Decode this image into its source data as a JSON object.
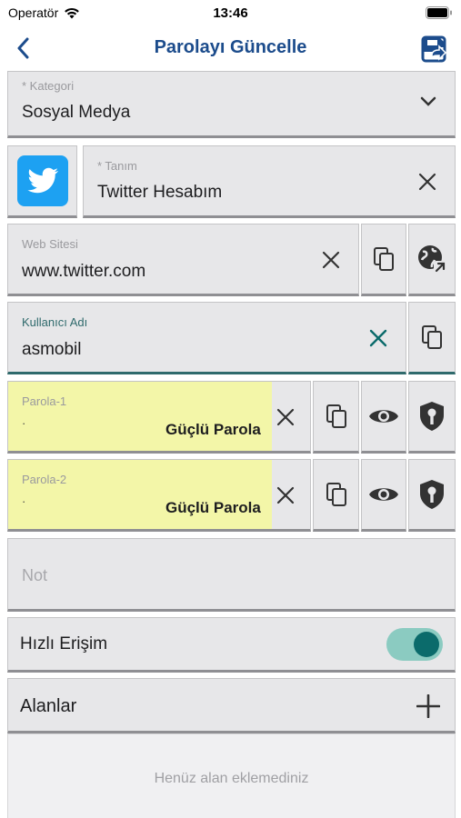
{
  "status": {
    "carrier": "Operatör",
    "time": "13:46"
  },
  "nav": {
    "title": "Parolayı Güncelle",
    "back_icon": "chevron-left-icon",
    "save_icon": "save-share-icon"
  },
  "category": {
    "label": "* Kategori",
    "value": "Sosyal Medya"
  },
  "definition": {
    "label": "* Tanım",
    "value": "Twitter Hesabım",
    "icon": "twitter-bird-icon"
  },
  "website": {
    "label": "Web Sitesi",
    "value": "www.twitter.com"
  },
  "username": {
    "label": "Kullanıcı Adı",
    "value": "asmobil"
  },
  "password1": {
    "label": "Parola-1",
    "value": "·",
    "strength": "Güçlü Parola"
  },
  "password2": {
    "label": "Parola-2",
    "value": "·",
    "strength": "Güçlü Parola"
  },
  "note": {
    "placeholder": "Not"
  },
  "quick_access": {
    "label": "Hızlı Erişim",
    "enabled": true
  },
  "fields": {
    "title": "Alanlar",
    "empty_text": "Henüz alan eklemediniz"
  },
  "colors": {
    "accent": "#1c4c8c",
    "teal": "#0b6b6b",
    "strong_password_bg": "#f3f6a8"
  }
}
